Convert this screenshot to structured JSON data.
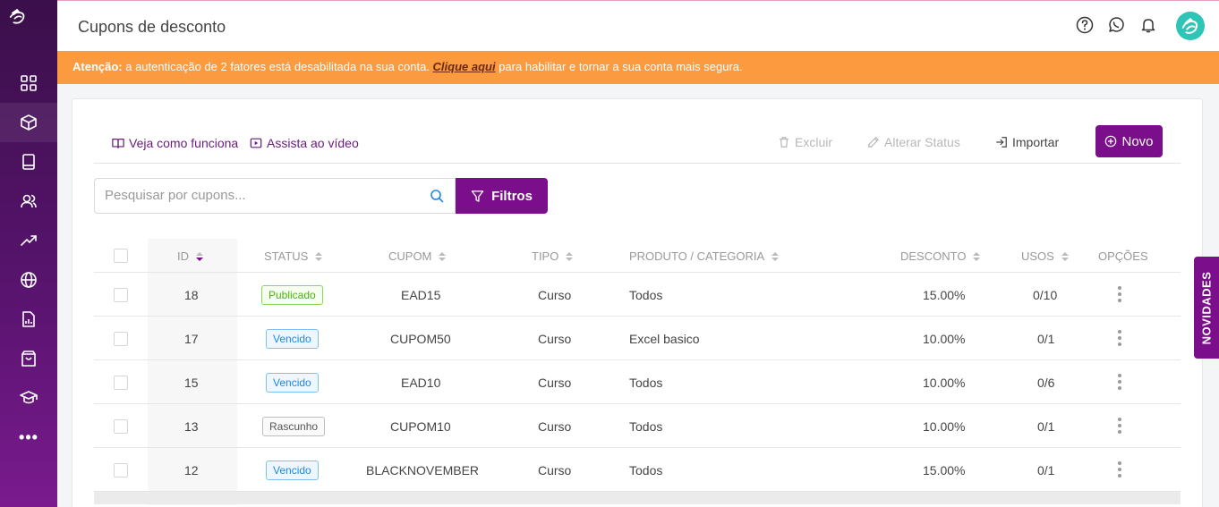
{
  "header": {
    "title": "Cupons de desconto"
  },
  "warning": {
    "label": "Atenção:",
    "text_before": " a autenticação de 2 fatores está desabilitada na sua conta. ",
    "link": "Clique aqui",
    "text_after": " para habilitar e tornar a sua conta mais segura."
  },
  "toolbar": {
    "how_it_works": "Veja como funciona",
    "watch_video": "Assista ao vídeo",
    "delete": "Excluir",
    "change_status": "Alterar Status",
    "import": "Importar",
    "new": "Novo"
  },
  "search": {
    "placeholder": "Pesquisar por cupons...",
    "filters": "Filtros"
  },
  "table": {
    "columns": {
      "id": "ID",
      "status": "STATUS",
      "cupom": "CUPOM",
      "tipo": "TIPO",
      "produto": "PRODUTO / CATEGORIA",
      "desconto": "DESCONTO",
      "usos": "USOS",
      "opcoes": "OPÇÕES"
    },
    "rows": [
      {
        "id": "18",
        "status": "Publicado",
        "status_color": "green",
        "cupom": "EAD15",
        "tipo": "Curso",
        "produto": "Todos",
        "desconto": "15.00%",
        "usos": "0/10"
      },
      {
        "id": "17",
        "status": "Vencido",
        "status_color": "blue",
        "cupom": "CUPOM50",
        "tipo": "Curso",
        "produto": "Excel basico",
        "desconto": "10.00%",
        "usos": "0/1"
      },
      {
        "id": "15",
        "status": "Vencido",
        "status_color": "blue",
        "cupom": "EAD10",
        "tipo": "Curso",
        "produto": "Todos",
        "desconto": "10.00%",
        "usos": "0/6"
      },
      {
        "id": "13",
        "status": "Rascunho",
        "status_color": "gray",
        "cupom": "CUPOM10",
        "tipo": "Curso",
        "produto": "Todos",
        "desconto": "10.00%",
        "usos": "0/1"
      },
      {
        "id": "12",
        "status": "Vencido",
        "status_color": "blue",
        "cupom": "BLACKNOVEMBER",
        "tipo": "Curso",
        "produto": "Todos",
        "desconto": "15.00%",
        "usos": "0/1"
      }
    ]
  },
  "sidebar": {
    "items": [
      "dashboard-icon",
      "products-icon",
      "book-icon",
      "users-icon",
      "trending-icon",
      "globe-icon",
      "reports-icon",
      "shopping-bag-icon",
      "graduation-icon",
      "more-icon"
    ]
  },
  "side_tab": {
    "label": "NOVIDADES"
  },
  "colors": {
    "primary": "#7b0e8a",
    "warning": "#fb9a3e",
    "sidebar_top": "#3a0f4a",
    "avatar": "#2ec4b6"
  }
}
